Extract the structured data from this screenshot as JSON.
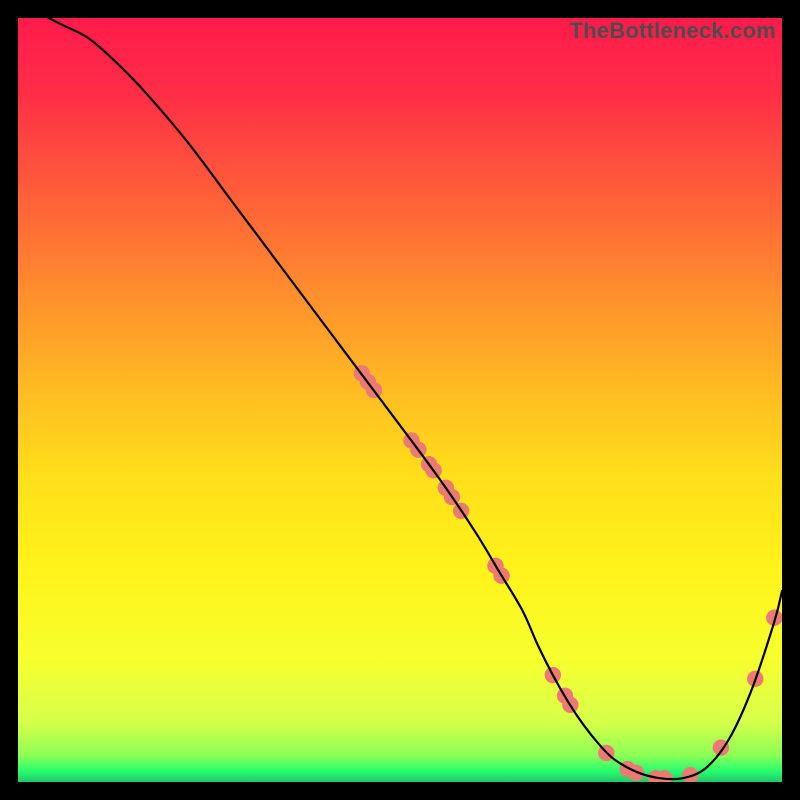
{
  "watermark": "TheBottleneck.com",
  "gradient": {
    "stops": [
      {
        "offset": 0.0,
        "color": "#ff1a4b"
      },
      {
        "offset": 0.1,
        "color": "#ff2e46"
      },
      {
        "offset": 0.22,
        "color": "#ff5a3a"
      },
      {
        "offset": 0.35,
        "color": "#ff8a2e"
      },
      {
        "offset": 0.48,
        "color": "#ffb922"
      },
      {
        "offset": 0.6,
        "color": "#ffdf1a"
      },
      {
        "offset": 0.72,
        "color": "#fff31a"
      },
      {
        "offset": 0.84,
        "color": "#f6ff2e"
      },
      {
        "offset": 0.92,
        "color": "#d8ff4a"
      },
      {
        "offset": 0.965,
        "color": "#8cff55"
      },
      {
        "offset": 0.985,
        "color": "#2aff6d"
      },
      {
        "offset": 1.0,
        "color": "#1ec96a"
      }
    ]
  },
  "chart_data": {
    "type": "line",
    "title": "",
    "xlabel": "",
    "ylabel": "",
    "xlim": [
      0,
      100
    ],
    "ylim": [
      0,
      100
    ],
    "series": [
      {
        "name": "bottleneck-curve",
        "stroke": "#000000",
        "stroke_width": 2.2,
        "x": [
          4,
          6,
          9,
          12,
          16,
          22,
          28,
          34,
          40,
          46,
          52,
          56,
          60,
          63,
          66,
          68,
          70,
          72,
          74,
          76,
          78,
          81,
          84,
          87,
          90,
          93,
          96,
          99,
          100
        ],
        "y": [
          100,
          99,
          97.5,
          95,
          91,
          84,
          76,
          68,
          60,
          52,
          44,
          38.5,
          32.5,
          27.5,
          22.5,
          18,
          14,
          10.5,
          7.5,
          5,
          3,
          1.3,
          0.5,
          0.5,
          1.8,
          5.5,
          12,
          21,
          25
        ]
      }
    ],
    "points": {
      "name": "sample-dots",
      "fill": "#eb7a74",
      "r": 8.2,
      "data": [
        {
          "x": 45.0,
          "y": 53.5
        },
        {
          "x": 45.8,
          "y": 52.4
        },
        {
          "x": 46.6,
          "y": 51.3
        },
        {
          "x": 51.5,
          "y": 44.7
        },
        {
          "x": 52.4,
          "y": 43.5
        },
        {
          "x": 53.8,
          "y": 41.6
        },
        {
          "x": 54.4,
          "y": 40.8
        },
        {
          "x": 56.0,
          "y": 38.5
        },
        {
          "x": 56.8,
          "y": 37.3
        },
        {
          "x": 58.0,
          "y": 35.5
        },
        {
          "x": 62.5,
          "y": 28.3
        },
        {
          "x": 63.3,
          "y": 27.0
        },
        {
          "x": 70.0,
          "y": 14.0
        },
        {
          "x": 71.6,
          "y": 11.3
        },
        {
          "x": 72.3,
          "y": 10.1
        },
        {
          "x": 77.0,
          "y": 3.8
        },
        {
          "x": 79.8,
          "y": 1.7
        },
        {
          "x": 80.9,
          "y": 1.2
        },
        {
          "x": 83.5,
          "y": 0.5
        },
        {
          "x": 84.6,
          "y": 0.5
        },
        {
          "x": 88.0,
          "y": 0.9
        },
        {
          "x": 92.0,
          "y": 4.5
        },
        {
          "x": 96.5,
          "y": 13.5
        },
        {
          "x": 99.0,
          "y": 21.5
        }
      ]
    }
  }
}
